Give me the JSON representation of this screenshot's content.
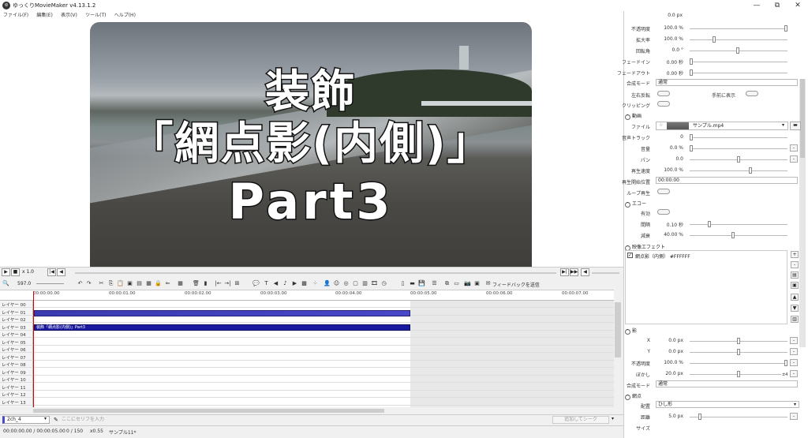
{
  "window": {
    "title": "ゆっくりMovieMaker v4.13.1.2",
    "icons": [
      "minimize-icon",
      "maximize-icon",
      "close-icon"
    ],
    "minimize": "—",
    "maximize": "⧉",
    "close": "✕"
  },
  "menu": [
    "ファイル(F)",
    "編集(E)",
    "表示(V)",
    "ツール(T)",
    "ヘルプ(H)"
  ],
  "preview": {
    "caption_line1": "装飾",
    "caption_line2": "「網点影(内側)」",
    "caption_line3": "Part3"
  },
  "playback": {
    "speed": "x 1.0"
  },
  "toolbar": {
    "zoom": "597.0",
    "feedback": "フィードバックを送信"
  },
  "ruler": [
    "00:00:00.00",
    "00:00:01.00",
    "00:00:02.00",
    "00:00:03.00",
    "00:00:04.00",
    "00:00:05.00",
    "00:00:06.00",
    "00:00:07.00"
  ],
  "layers": [
    "レイヤー 00",
    "レイヤー 01",
    "レイヤー 02",
    "レイヤー 03",
    "レイヤー 04",
    "レイヤー 05",
    "レイヤー 06",
    "レイヤー 07",
    "レイヤー 08",
    "レイヤー 09",
    "レイヤー 10",
    "レイヤー 11",
    "レイヤー 12",
    "レイヤー 13"
  ],
  "clips": {
    "text_clip": "装飾「網点影(内側)」Part3"
  },
  "bottom": {
    "character": "2ch_4",
    "serif_placeholder": "ここにセリフを入力",
    "add_button": "追加してシーク"
  },
  "status": {
    "time": "00:00:00.00 / 00:00:05.00",
    "frame": "0 / 150",
    "zoom": "x0.55",
    "file": "サンプル11*"
  },
  "props": {
    "top_value": "0.0 px",
    "opacity_label": "不透明度",
    "opacity": "100.0 %",
    "scale_label": "拡大率",
    "scale": "100.0 %",
    "rotate_label": "回転角",
    "rotate": "0.0 °",
    "fadein_label": "フェードイン",
    "fadein": "0.00 秒",
    "fadeout_label": "フェードアウト",
    "fadeout": "0.00 秒",
    "blend_label": "合成モード",
    "blend": "通常",
    "flip_label": "左右反転",
    "front_label": "手前に表示",
    "clip_label": "クリッピング",
    "video_section": "動画",
    "file_label": "ファイル",
    "file": "サンプル.mp4",
    "audio_track_label": "音声トラック",
    "audio_track": "0",
    "volume_label": "音量",
    "volume": "0.0 %",
    "pan_label": "パン",
    "pan": "0.0",
    "speed_label": "再生速度",
    "speed": "100.0 %",
    "start_label": "再生開始位置",
    "start": "00:00:00",
    "loop_label": "ループ再生",
    "echo_section": "エコー",
    "echo_enabled_label": "有効",
    "interval_label": "間隔",
    "interval": "0.10 秒",
    "decay_label": "減衰",
    "decay": "40.00 %",
    "effect_section": "映像エフェクト",
    "effect_item": "網点影（内側） #FFFFFF",
    "shadow_section": "影",
    "x_label": "X",
    "x": "0.0 px",
    "y_label": "Y",
    "y": "0.0 px",
    "s_opacity_label": "不透明度",
    "s_opacity": "100.0 %",
    "blur_label": "ぼかし",
    "blur": "20.0 px",
    "blur_max": "±4",
    "s_blend_label": "合成モード",
    "s_blend": "通常",
    "halftone_section": "網点",
    "layout_label": "配置",
    "layout": "ひし形",
    "spacing_label": "距離",
    "spacing": "5.0 px",
    "size_label": "サイズ"
  }
}
